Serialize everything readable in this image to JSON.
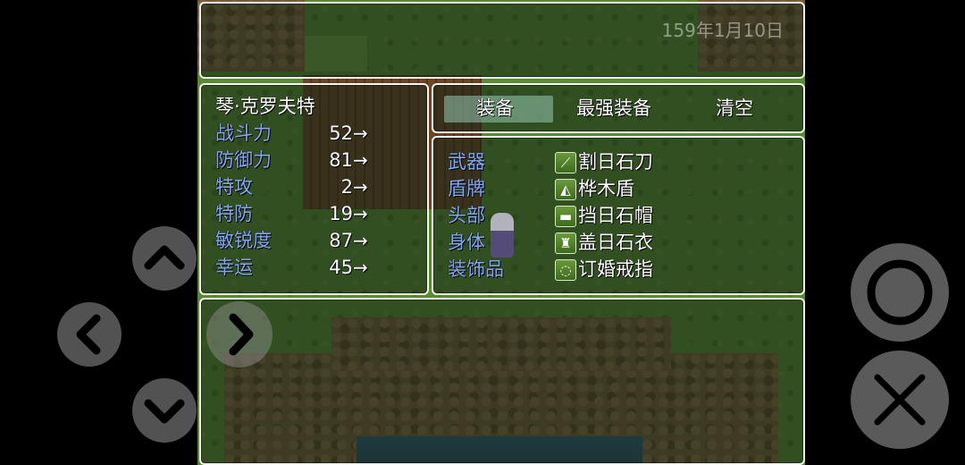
{
  "date": "159年1月10日",
  "actor": {
    "name": "琴·克罗夫特",
    "stats": [
      {
        "label": "战斗力",
        "value": "52",
        "arrow": "→"
      },
      {
        "label": "防御力",
        "value": "81",
        "arrow": "→"
      },
      {
        "label": "特攻",
        "value": "2",
        "arrow": "→"
      },
      {
        "label": "特防",
        "value": "19",
        "arrow": "→"
      },
      {
        "label": "敏锐度",
        "value": "87",
        "arrow": "→"
      },
      {
        "label": "幸运",
        "value": "45",
        "arrow": "→"
      }
    ]
  },
  "commands": [
    "装备",
    "最强装备",
    "清空"
  ],
  "selected_command": "装备",
  "slots": [
    {
      "slot": "武器",
      "item": "割日石刀",
      "icon": "sword-icon",
      "glyph": "⟋"
    },
    {
      "slot": "盾牌",
      "item": "桦木盾",
      "icon": "shield-icon",
      "glyph": "◭"
    },
    {
      "slot": "头部",
      "item": "挡日石帽",
      "icon": "hat-icon",
      "glyph": "▬"
    },
    {
      "slot": "身体",
      "item": "盖日石衣",
      "icon": "armor-icon",
      "glyph": "♜"
    },
    {
      "slot": "装饰品",
      "item": "订婚戒指",
      "icon": "ring-icon",
      "glyph": "◌"
    }
  ],
  "controls": [
    "dpad-up",
    "dpad-left",
    "dpad-right",
    "dpad-down",
    "confirm-button",
    "cancel-button"
  ]
}
